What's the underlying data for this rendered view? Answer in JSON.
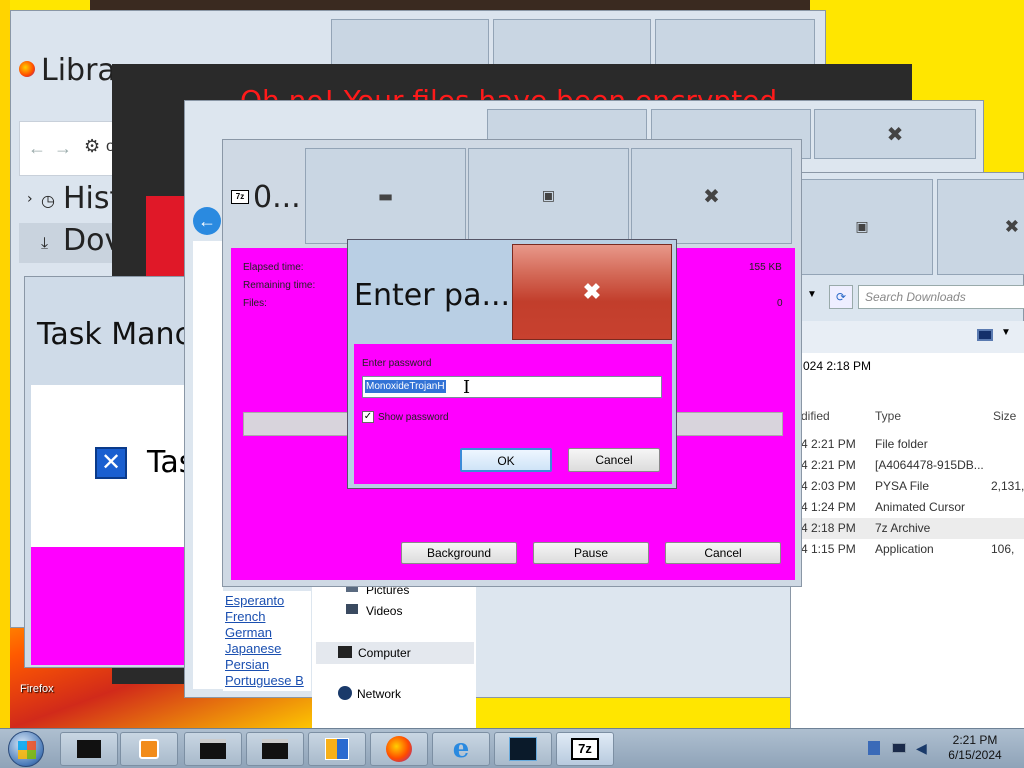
{
  "desktop": {
    "firefox_label": "Firefox"
  },
  "ff_library": {
    "title": "Libra",
    "history": "Hist",
    "downloads": "Dov",
    "toolbar_glyph_gear": "⚙",
    "back": "←",
    "fwd": "→",
    "partial_char": "o"
  },
  "ransom": {
    "text": "Oh no! Your files have been encrypted"
  },
  "task_manager": {
    "title": "Task Manc",
    "body_text": "Tas"
  },
  "explorer": {
    "search_placeholder": "Search Downloads",
    "date_modified_header": "dified",
    "type_header": "Type",
    "size_header": "Size",
    "top_date": "024 2:18 PM",
    "rows": [
      {
        "date": "4 2:21 PM",
        "type": "File folder",
        "size": ""
      },
      {
        "date": "4 2:21 PM",
        "type": "[A4064478-915DB...",
        "size": ""
      },
      {
        "date": "4 2:03 PM",
        "type": "PYSA File",
        "size": "2,131,"
      },
      {
        "date": "4 1:24 PM",
        "type": "Animated Cursor",
        "size": ""
      },
      {
        "date": "4 2:18 PM",
        "type": "7z Archive",
        "size": ""
      },
      {
        "date": "4 1:15 PM",
        "type": "Application",
        "size": "106,"
      }
    ],
    "nav": {
      "pictures": "Pictures",
      "videos": "Videos",
      "computer": "Computer",
      "network": "Network"
    }
  },
  "languages": [
    "Esperanto",
    "French",
    "German",
    "Japanese",
    "Persian",
    "Portuguese B"
  ],
  "zip": {
    "title": "0...",
    "elapsed_label": "Elapsed time:",
    "remaining_label": "Remaining time:",
    "files_label": "Files:",
    "size_value": "155 KB",
    "files_value": "0",
    "background_btn": "Background",
    "pause_btn": "Pause",
    "cancel_btn": "Cancel"
  },
  "dialog": {
    "title": "Enter pa...",
    "prompt": "Enter password",
    "password_value": "MonoxideTrojanH",
    "show_password_label": "Show password",
    "show_password_checked": true,
    "ok_label": "OK",
    "cancel_label": "Cancel"
  },
  "taskbar": {
    "time": "2:21 PM",
    "date": "6/15/2024",
    "zip_icon_text": "7z"
  },
  "colors": {
    "magenta": "#ff00ff",
    "close_red": "#c8412f",
    "desktop_yellow": "#ffe600"
  }
}
